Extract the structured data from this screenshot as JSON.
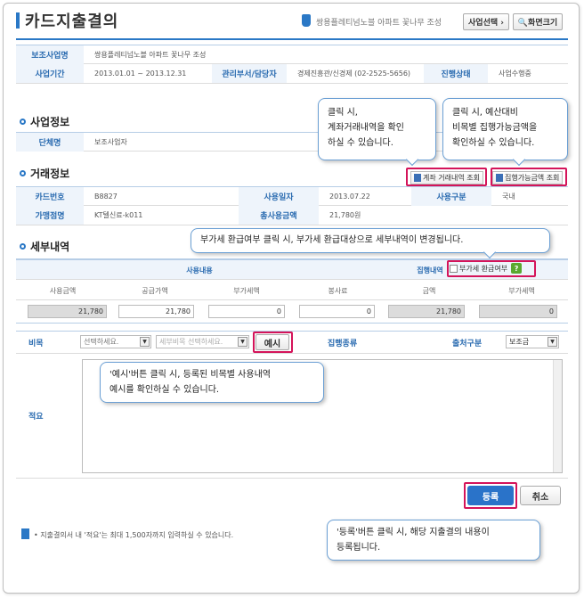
{
  "header": {
    "title": "카드지출결의",
    "project_name": "쌍용플레티넘노블 아파트 꽃나무 조성",
    "select_btn": "사업선택 ›",
    "screen_btn": "🔍화면크기"
  },
  "info": {
    "r1": {
      "label1": "보조사업명",
      "value1": "쌍용플레티넘노블 아파트 꽃나무 조성"
    },
    "r2": {
      "label1": "사업기간",
      "value1": "2013.01.01 ~ 2013.12.31",
      "label2": "관리부서/담당자",
      "value2": "경제진흥관/신경제 (02-2525-5656)",
      "label3": "진행상태",
      "value3": "사업수행중"
    }
  },
  "biz": {
    "title": "사업정보",
    "label": "단체명",
    "value": "보조사업자"
  },
  "trade": {
    "title": "거래정보",
    "btn_account": "계좌 거래내역 조회",
    "btn_balance": "집행가능금액 조회",
    "r1": {
      "l1": "카드번호",
      "v1": "B8827",
      "l2": "사용일자",
      "v2": "2013.07.22",
      "l3": "사용구분",
      "v3": "국내"
    },
    "r2": {
      "l1": "가맹점명",
      "v1": "KT텔신료-k011",
      "l2": "총사용금액",
      "v2": "21,780원"
    }
  },
  "detail": {
    "title": "세부내역",
    "group_usage": "사용내용",
    "group_exec": "집행내역",
    "vat_refund": "부가세 환급여부",
    "help": "?",
    "cols": [
      "사용금액",
      "공급가액",
      "부가세액",
      "봉사료",
      "금액",
      "부가세액"
    ],
    "values": [
      "21,780",
      "21,780",
      "0",
      "0",
      "21,780",
      "0"
    ],
    "item_label": "비목",
    "item_select": "선택하세요.",
    "sub_item_select": "세부비목 선택하세요.",
    "example_btn": "예시",
    "exec_type_label": "집행종류",
    "source_label": "출처구분",
    "source_value": "보조금",
    "memo_label": "적요"
  },
  "actions": {
    "register": "등록",
    "cancel": "취소"
  },
  "notice": "• 지출결의서 내 '적요'는 최대 1,500자까지 입력하실 수 있습니다.",
  "callouts": {
    "c1": [
      "클릭 시,",
      "계좌거래내역을 확인",
      "하실 수 있습니다."
    ],
    "c2": [
      "클릭 시, 예산대비",
      "비목별 집행가능금액을",
      "확인하실 수 있습니다."
    ],
    "c3": "부가세 환급여부 클릭 시, 부가세 환급대상으로 세부내역이 변경됩니다.",
    "c4": [
      "'예시'버튼 클릭 시, 등록된 비목별 사용내역",
      "예시를 확인하실 수 있습니다."
    ],
    "c5": [
      "'등록'버튼 클릭 시, 해당 지출결의 내용이",
      "등록됩니다."
    ]
  },
  "colors": {
    "accent": "#2a78c6",
    "highlight": "#d4145a",
    "register": "#2a73c9"
  }
}
